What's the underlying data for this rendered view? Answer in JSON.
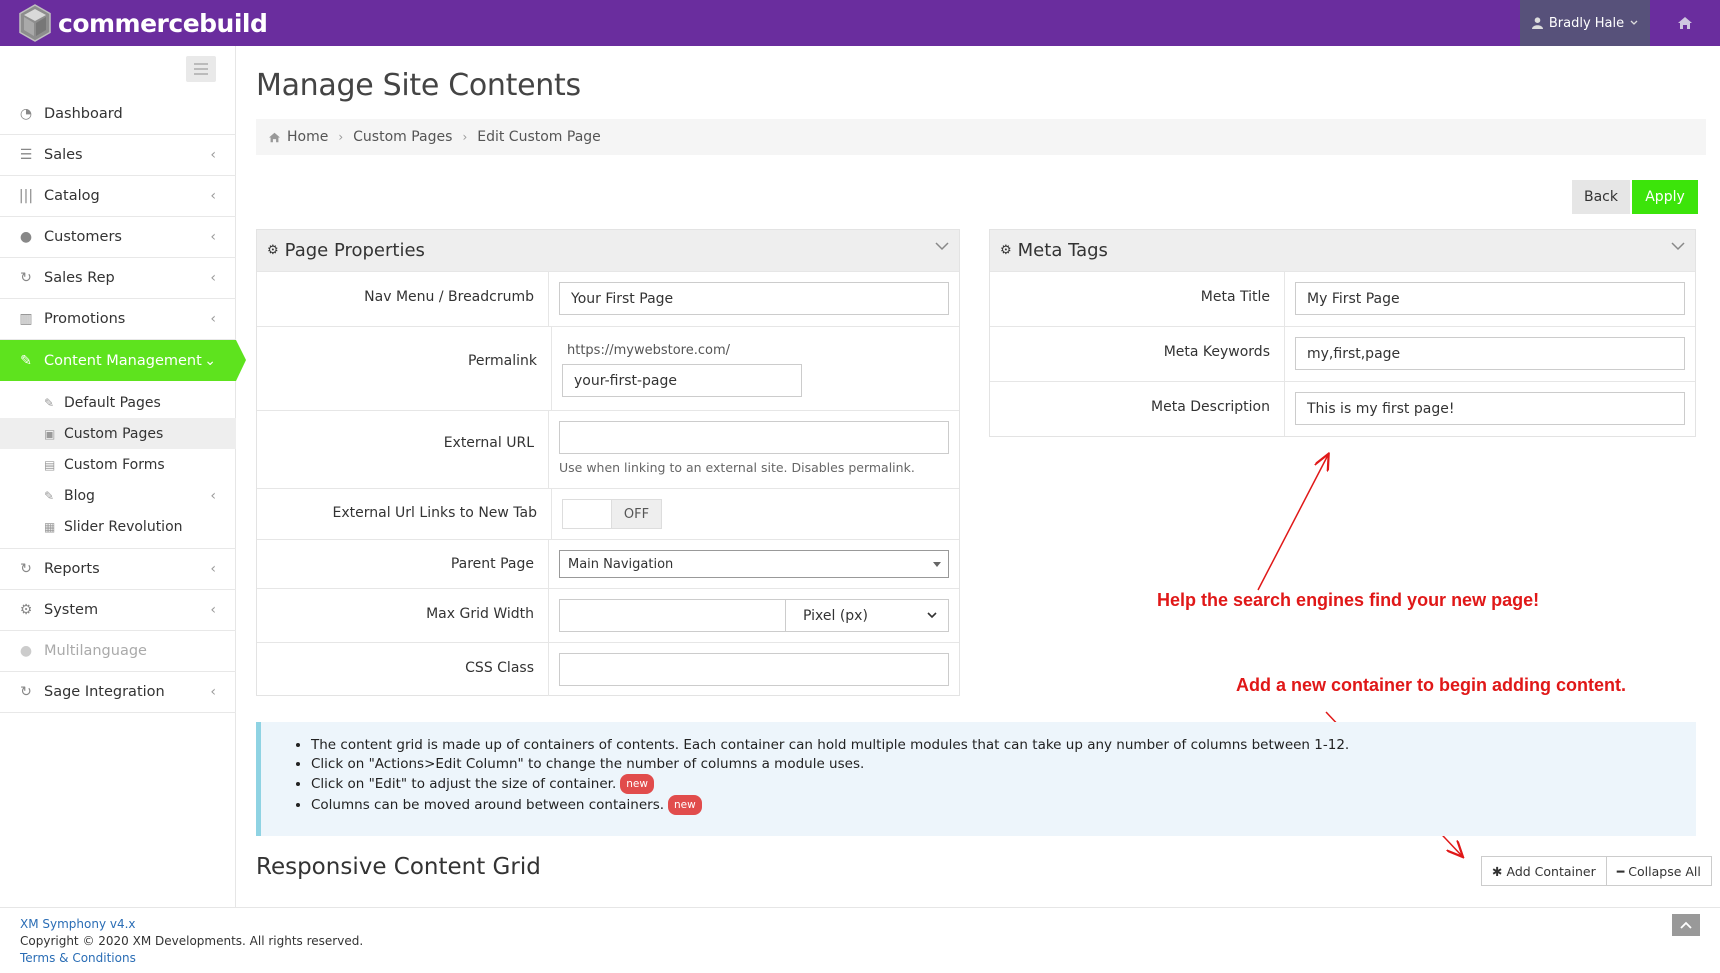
{
  "app": {
    "brand": "commercebuild",
    "user_name": "Bradly Hale",
    "colors": {
      "topbar": "#6a2d9e",
      "active": "#5ee31e",
      "apply": "#3ce40a",
      "annotation": "#e01818"
    }
  },
  "sidebar": {
    "items": [
      {
        "label": "Dashboard",
        "icon": "dashboard-icon"
      },
      {
        "label": "Sales",
        "icon": "sales-icon"
      },
      {
        "label": "Catalog",
        "icon": "barcode-icon"
      },
      {
        "label": "Customers",
        "icon": "user-icon"
      },
      {
        "label": "Sales Rep",
        "icon": "refresh-icon"
      },
      {
        "label": "Promotions",
        "icon": "bar-chart-icon"
      },
      {
        "label": "Content Management",
        "icon": "edit-icon"
      }
    ],
    "sub_items": [
      {
        "label": "Default Pages",
        "icon": "pencil-icon"
      },
      {
        "label": "Custom Pages",
        "icon": "edit-square-icon"
      },
      {
        "label": "Custom Forms",
        "icon": "document-icon"
      },
      {
        "label": "Blog",
        "icon": "pencil-icon"
      },
      {
        "label": "Slider Revolution",
        "icon": "image-icon"
      }
    ],
    "bottom_items": [
      {
        "label": "Reports",
        "icon": "refresh-icon"
      },
      {
        "label": "System",
        "icon": "gears-icon"
      },
      {
        "label": "Multilanguage",
        "icon": "users-icon"
      },
      {
        "label": "Sage Integration",
        "icon": "refresh-icon"
      }
    ]
  },
  "page": {
    "title": "Manage Site Contents",
    "breadcrumb": [
      "Home",
      "Custom Pages",
      "Edit Custom Page"
    ],
    "back_label": "Back",
    "apply_label": "Apply"
  },
  "page_properties": {
    "title": "Page Properties",
    "nav_menu_label": "Nav Menu / Breadcrumb",
    "nav_menu_value": "Your First Page",
    "permalink_label": "Permalink",
    "permalink_base": "https://mywebstore.com/",
    "permalink_value": "your-first-page",
    "external_url_label": "External URL",
    "external_url_value": "",
    "external_url_help": "Use when linking to an external site. Disables permalink.",
    "new_tab_label": "External Url Links to New Tab",
    "new_tab_state": "OFF",
    "parent_page_label": "Parent Page",
    "parent_page_value": "Main Navigation",
    "max_grid_label": "Max Grid Width",
    "max_grid_value": "",
    "max_grid_unit": "Pixel (px)",
    "css_class_label": "CSS Class",
    "css_class_value": ""
  },
  "meta_tags": {
    "title": "Meta Tags",
    "meta_title_label": "Meta Title",
    "meta_title_value": "My First Page",
    "meta_keywords_label": "Meta Keywords",
    "meta_keywords_value": "my,first,page",
    "meta_description_label": "Meta Description",
    "meta_description_value": "This is my first page!"
  },
  "annotations": {
    "search": "Help the search engines find your new page!",
    "container": "Add a new container to begin adding content."
  },
  "info": {
    "items": [
      {
        "text": "The content grid is made up of containers of contents. Each container can hold multiple modules that can take up any number of columns between 1-12.",
        "badge": ""
      },
      {
        "text": "Click on \"Actions>Edit Column\" to change the number of columns a module uses.",
        "badge": ""
      },
      {
        "text": "Click on \"Edit\" to adjust the size of container.",
        "badge": "new"
      },
      {
        "text": "Columns can be moved around between containers.",
        "badge": "new"
      }
    ]
  },
  "grid": {
    "title": "Responsive Content Grid",
    "add_label": "Add Container",
    "collapse_label": "Collapse All"
  },
  "footer": {
    "version": "XM Symphony  v4.x",
    "copyright": "Copyright © 2020 XM Developments. All rights reserved.",
    "terms": "Terms & Conditions"
  }
}
